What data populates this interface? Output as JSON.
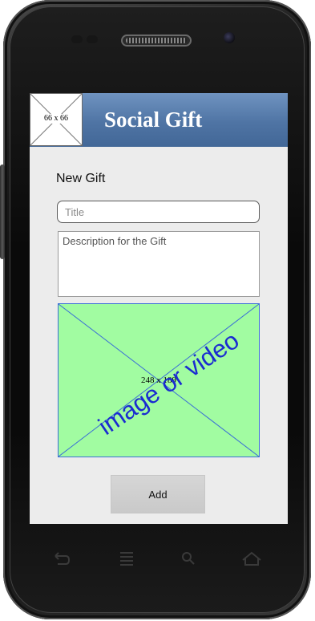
{
  "app": {
    "title": "Social Gift",
    "logo_placeholder": "66 x 66"
  },
  "form": {
    "heading": "New Gift",
    "title_placeholder": "Title",
    "description_placeholder": "Description for the Gift",
    "media_placeholder_label": "image or video",
    "media_placeholder_dims": "248 x 189",
    "add_label": "Add"
  },
  "icons": {
    "back": "back-icon",
    "menu": "menu-icon",
    "search": "search-icon",
    "home": "home-icon"
  },
  "colors": {
    "header_blue": "#4f74a4",
    "media_green": "#a1fca1",
    "media_text": "#1a2bd1",
    "screen_bg": "#ececec"
  }
}
